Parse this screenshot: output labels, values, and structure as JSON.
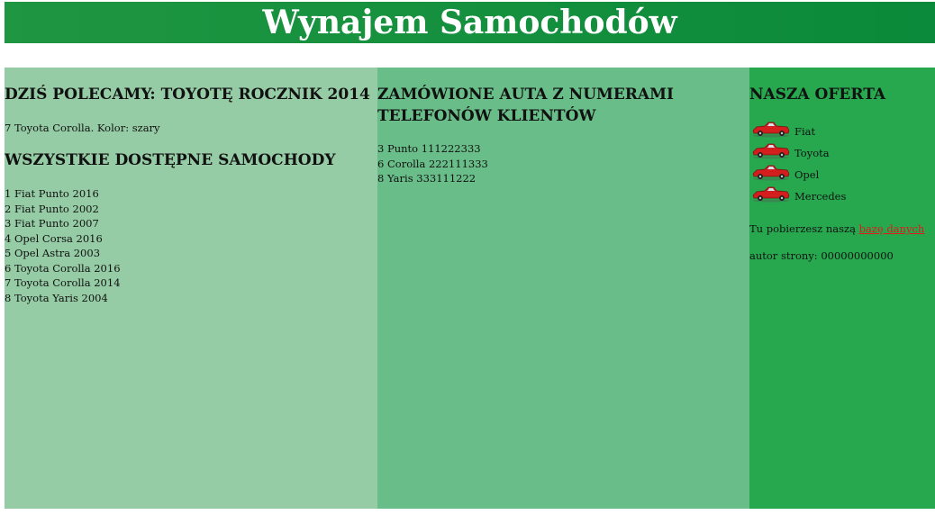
{
  "header": {
    "title": "Wynajem Samochodów"
  },
  "left": {
    "recommend_heading": "DZIŚ POLECAMY: TOYOTĘ ROCZNIK 2014",
    "recommend_text": "7 Toyota Corolla. Kolor: szary",
    "all_heading": "WSZYSTKIE DOSTĘPNE SAMOCHODY",
    "cars": [
      "1 Fiat Punto 2016",
      "2 Fiat Punto 2002",
      "3 Fiat Punto 2007",
      "4 Opel Corsa 2016",
      "5 Opel Astra 2003",
      "6 Toyota Corolla 2016",
      "7 Toyota Corolla 2014",
      "8 Toyota Yaris 2004"
    ]
  },
  "middle": {
    "heading_line1": "ZAMÓWIONE AUTA Z NUMERAMI",
    "heading_line2": "TELEFONÓW KLIENTÓW",
    "orders": [
      "3 Punto 111222333",
      "6 Corolla 222111333",
      "8 Yaris 333111222"
    ]
  },
  "right": {
    "heading": "NASZA OFERTA",
    "brands": [
      "Fiat",
      "Toyota",
      "Opel",
      "Mercedes"
    ],
    "download_text": "Tu pobierzesz naszą ",
    "download_link": "bazę danych",
    "author": "autor strony: 00000000000"
  },
  "colors": {
    "header": "#1f9641",
    "left_panel": "#95cca5",
    "middle_panel": "#69bd88",
    "right_panel": "#27a84f",
    "link": "#e01a1a"
  },
  "icons": {
    "car": "red-convertible-car-icon"
  }
}
